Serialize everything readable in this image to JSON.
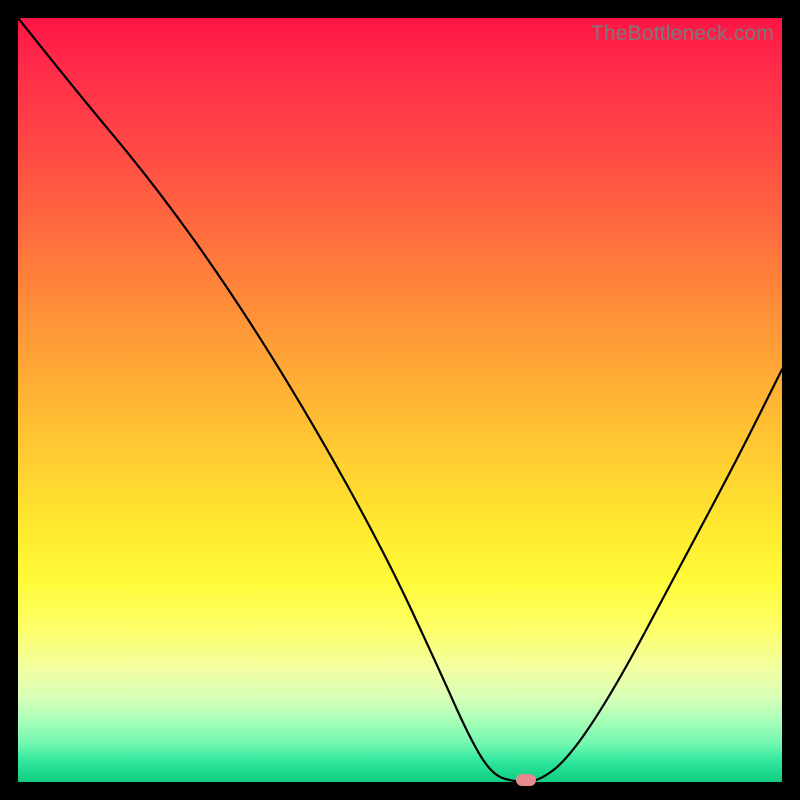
{
  "watermark": "TheBottleneck.com",
  "chart_data": {
    "type": "line",
    "title": "",
    "xlabel": "",
    "ylabel": "",
    "xlim": [
      0,
      100
    ],
    "ylim": [
      0,
      100
    ],
    "series": [
      {
        "name": "bottleneck-curve",
        "x": [
          0,
          8,
          18,
          28,
          38,
          48,
          55,
          59,
          62,
          65,
          68,
          72,
          78,
          86,
          94,
          100
        ],
        "values": [
          100,
          90,
          78,
          64,
          48,
          30,
          15,
          6,
          1,
          0,
          0,
          3,
          12,
          27,
          42,
          54
        ]
      }
    ],
    "marker": {
      "x": 66.5,
      "y": 0.3,
      "color": "#e78b8f"
    },
    "background_gradient": {
      "stops": [
        {
          "pos": 0,
          "color": "#ff1445"
        },
        {
          "pos": 0.18,
          "color": "#ff4b44"
        },
        {
          "pos": 0.44,
          "color": "#ffa236"
        },
        {
          "pos": 0.66,
          "color": "#ffe72f"
        },
        {
          "pos": 0.85,
          "color": "#f3ffa0"
        },
        {
          "pos": 1.0,
          "color": "#11cd81"
        }
      ]
    }
  }
}
